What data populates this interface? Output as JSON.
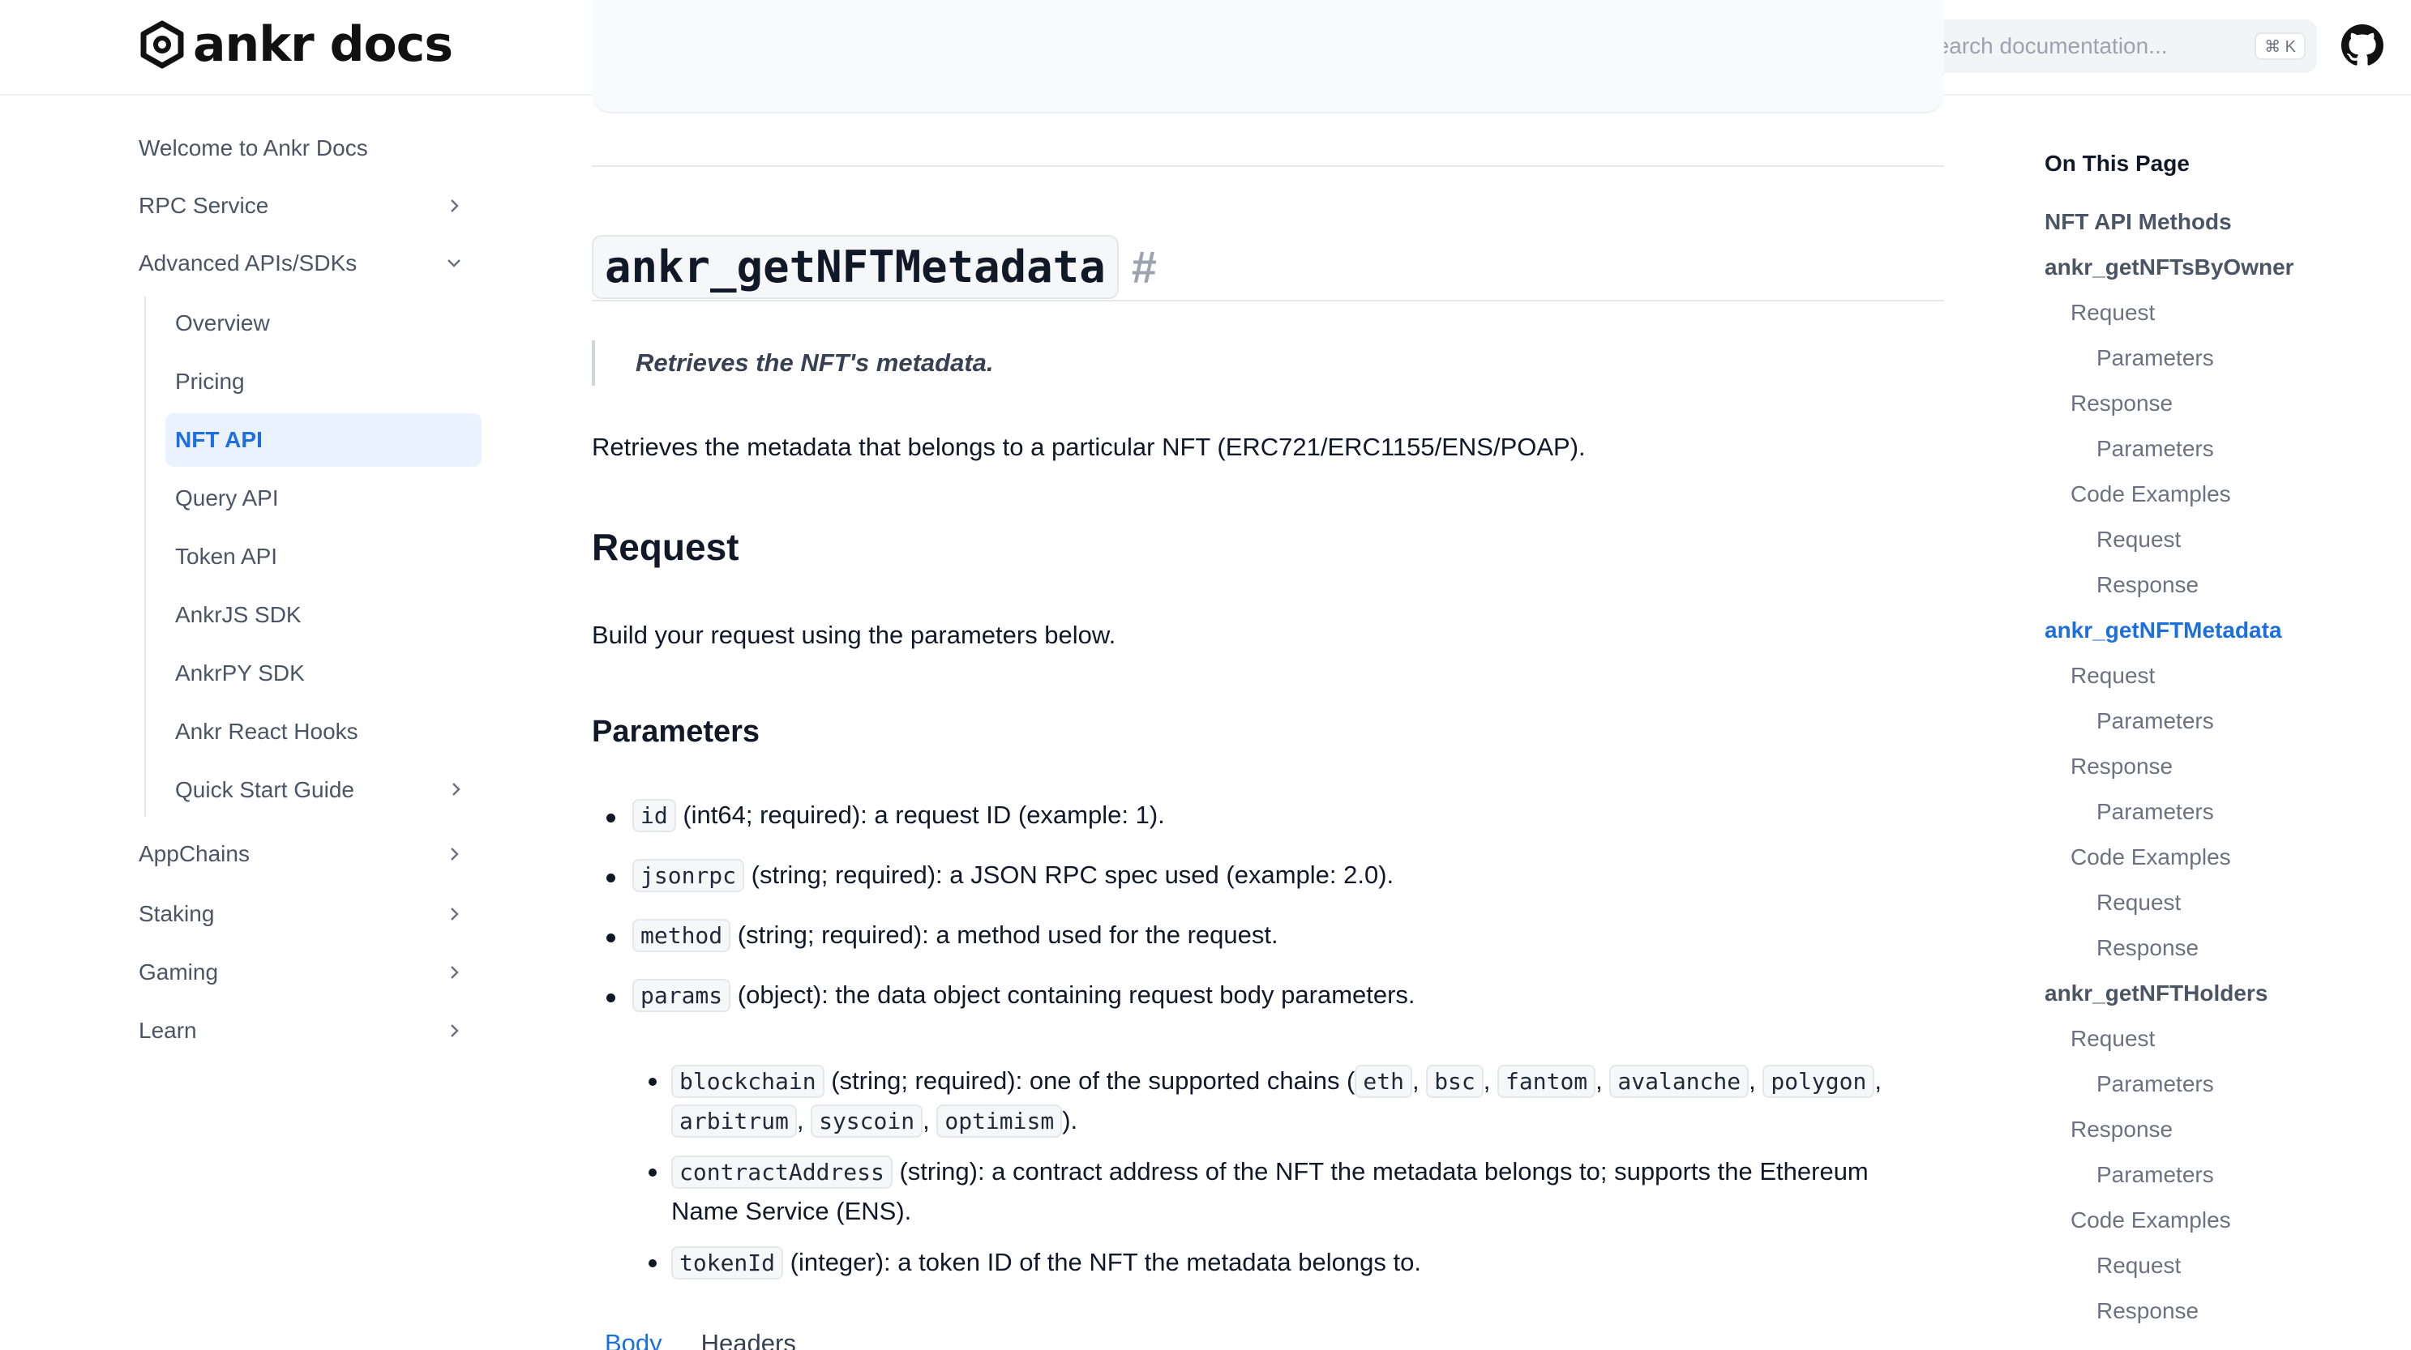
{
  "header": {
    "logo_text": "ankr docs",
    "search_placeholder": "Search documentation...",
    "search_shortcut": "⌘ K"
  },
  "sidebar": {
    "items": [
      {
        "label": "Welcome to Ankr Docs"
      },
      {
        "label": "RPC Service"
      },
      {
        "label": "Advanced APIs/SDKs"
      },
      {
        "label": "AppChains"
      },
      {
        "label": "Staking"
      },
      {
        "label": "Gaming"
      },
      {
        "label": "Learn"
      }
    ],
    "sub_items": [
      {
        "label": "Overview"
      },
      {
        "label": "Pricing"
      },
      {
        "label": "NFT API"
      },
      {
        "label": "Query API"
      },
      {
        "label": "Token API"
      },
      {
        "label": "AnkrJS SDK"
      },
      {
        "label": "AnkrPY SDK"
      },
      {
        "label": "Ankr React Hooks"
      },
      {
        "label": "Quick Start Guide"
      }
    ]
  },
  "main": {
    "title": "ankr_getNFTMetadata",
    "anchor": "#",
    "quote": "Retrieves the NFT's metadata.",
    "intro": "Retrieves the metadata that belongs to a particular NFT (ERC721/ERC1155/ENS/POAP).",
    "request_heading": "Request",
    "request_text": "Build your request using the parameters below.",
    "params_heading": "Parameters",
    "params": [
      {
        "name": "id",
        "desc": " (int64; required): a request ID (example: 1)."
      },
      {
        "name": "jsonrpc",
        "desc": " (string; required): a JSON RPC spec used (example: 2.0)."
      },
      {
        "name": "method",
        "desc": " (string; required): a method used for the request."
      },
      {
        "name": "params",
        "desc": " (object): the data object containing request body parameters."
      }
    ],
    "blockchain": {
      "name": "blockchain",
      "desc": " (string; required): one of the supported chains (",
      "chains": [
        "eth",
        "bsc",
        "fantom",
        "avalanche",
        "polygon",
        "arbitrum",
        "syscoin",
        "optimism"
      ],
      "sep": ", ",
      "end": ")."
    },
    "contract": {
      "name": "contractAddress",
      "desc_line1": " (string): a contract address of the NFT the metadata belongs to; supports the Ethereum",
      "desc_line2": "Name Service (ENS)."
    },
    "token": {
      "name": "tokenId",
      "desc": " (integer): a token ID of the NFT the metadata belongs to."
    },
    "tabs": {
      "body": "Body",
      "headers": "Headers"
    }
  },
  "toc": {
    "title": "On This Page",
    "items": [
      {
        "label": "NFT API Methods",
        "level": 1
      },
      {
        "label": "ankr_getNFTsByOwner",
        "level": 1
      },
      {
        "label": "Request",
        "level": 2
      },
      {
        "label": "Parameters",
        "level": 3
      },
      {
        "label": "Response",
        "level": 2
      },
      {
        "label": "Parameters",
        "level": 3
      },
      {
        "label": "Code Examples",
        "level": 2
      },
      {
        "label": "Request",
        "level": 3
      },
      {
        "label": "Response",
        "level": 3
      },
      {
        "label": "ankr_getNFTMetadata",
        "level": 1,
        "active": true
      },
      {
        "label": "Request",
        "level": 2
      },
      {
        "label": "Parameters",
        "level": 3
      },
      {
        "label": "Response",
        "level": 2
      },
      {
        "label": "Parameters",
        "level": 3
      },
      {
        "label": "Code Examples",
        "level": 2
      },
      {
        "label": "Request",
        "level": 3
      },
      {
        "label": "Response",
        "level": 3
      },
      {
        "label": "ankr_getNFTHolders",
        "level": 1
      },
      {
        "label": "Request",
        "level": 2
      },
      {
        "label": "Parameters",
        "level": 3
      },
      {
        "label": "Response",
        "level": 2
      },
      {
        "label": "Parameters",
        "level": 3
      },
      {
        "label": "Code Examples",
        "level": 2
      },
      {
        "label": "Request",
        "level": 3
      },
      {
        "label": "Response",
        "level": 3
      }
    ]
  },
  "colors": {
    "accent": "#1d6fe0",
    "active_bg": "#eaf2ff",
    "text": "#111827",
    "muted": "#6b7280"
  }
}
